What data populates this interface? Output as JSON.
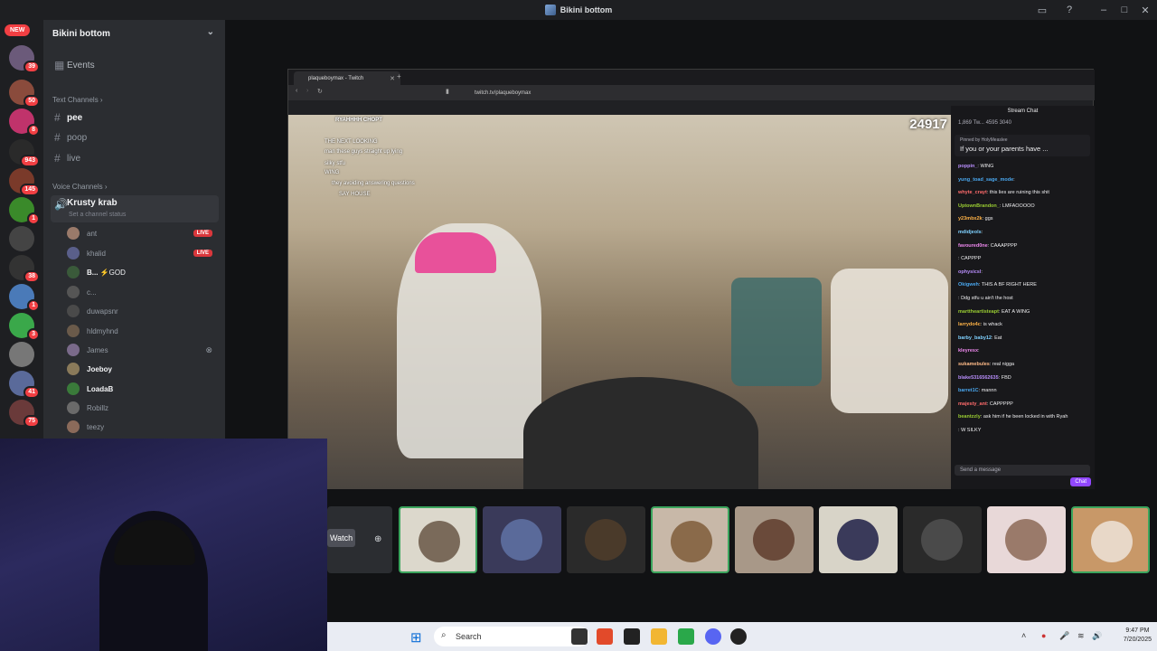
{
  "window": {
    "title": "Bikini bottom"
  },
  "rail": {
    "new_label": "NEW",
    "badges": [
      "28",
      "39",
      "50",
      "8",
      "943",
      "145",
      "1",
      "38",
      "1",
      "2",
      "3",
      "41",
      "75"
    ]
  },
  "sidebar": {
    "server_name": "Bikini bottom",
    "events_label": "Events",
    "text_channels_label": "Text Channels",
    "text_channels": [
      "pee",
      "poop",
      "live"
    ],
    "voice_channels_label": "Voice Channels",
    "voice_channel": "Krusty krab",
    "channel_status": "Set a channel status",
    "live_badge": "LIVE",
    "users": [
      "ant",
      "khalid",
      "B...",
      "c...",
      "duwapsnr",
      "hldmyhnd",
      "James",
      "Joeboy",
      "LoadaB",
      "Robillz",
      "teezy"
    ],
    "b_suffix": "⚡GOD"
  },
  "browser": {
    "tab_title": "plaqueboymax - Twitch",
    "url": "twitch.tv/plaqueboymax",
    "viewer_count": "24917",
    "overlay_lines": [
      "RYAHHHH CHOPT",
      "THE NEXT LOOKING",
      "man these guys straight up lying",
      "silky stfu",
      "WING",
      "they avoiding answering questions",
      "SAY HOUSE"
    ]
  },
  "chat": {
    "header": "Stream Chat",
    "stats": "1,869  Tw...  4595  3040",
    "pinned_label": "Pinned by HolyMeaslee",
    "pinned_text": "If you or your parents have ...",
    "messages": [
      {
        "user": "poppin_",
        "text": "WING"
      },
      {
        "user": "yung_toad_sage_mode",
        "text": ""
      },
      {
        "user": "whyte_crayt",
        "text": "this lies are ruining this shit"
      },
      {
        "user": "UptownBrandon_",
        "text": "LMFAOOOOO"
      },
      {
        "user": "y23mbx2k",
        "text": "ggs"
      },
      {
        "user": "mdidjeols",
        "text": ""
      },
      {
        "user": "favoured0ne",
        "text": "CAAAPPPP"
      },
      {
        "user": "",
        "text": "CAPPPP"
      },
      {
        "user": "ophysicsl",
        "text": ""
      },
      {
        "user": "Okigweh",
        "text": "THIS A BF RIGHT HERE"
      },
      {
        "user": "",
        "text": "Ddg stfu u ain't the host"
      },
      {
        "user": "marttheartisteapt",
        "text": "EAT A WING"
      },
      {
        "user": "larrydo4c",
        "text": "is whack"
      },
      {
        "user": "barby_baby12",
        "text": "Eat"
      },
      {
        "user": "kleyresx",
        "text": ""
      },
      {
        "user": "sukamebules",
        "text": "real nigga"
      },
      {
        "user": "blake5316562635",
        "text": "FBD"
      },
      {
        "user": "barret1C",
        "text": "mannn"
      },
      {
        "user": "majesty_ant",
        "text": "CAPPPPP"
      },
      {
        "user": "beantzzly",
        "text": "ask him if he been locked in with Ryah"
      },
      {
        "user": "",
        "text": "W SILKY"
      }
    ],
    "input_placeholder": "Send a message",
    "chat_button": "Chat"
  },
  "stage": {
    "watch_label": "Watch"
  },
  "taskbar": {
    "search_placeholder": "Search",
    "time": "9:47 PM",
    "date": "7/20/2025"
  }
}
